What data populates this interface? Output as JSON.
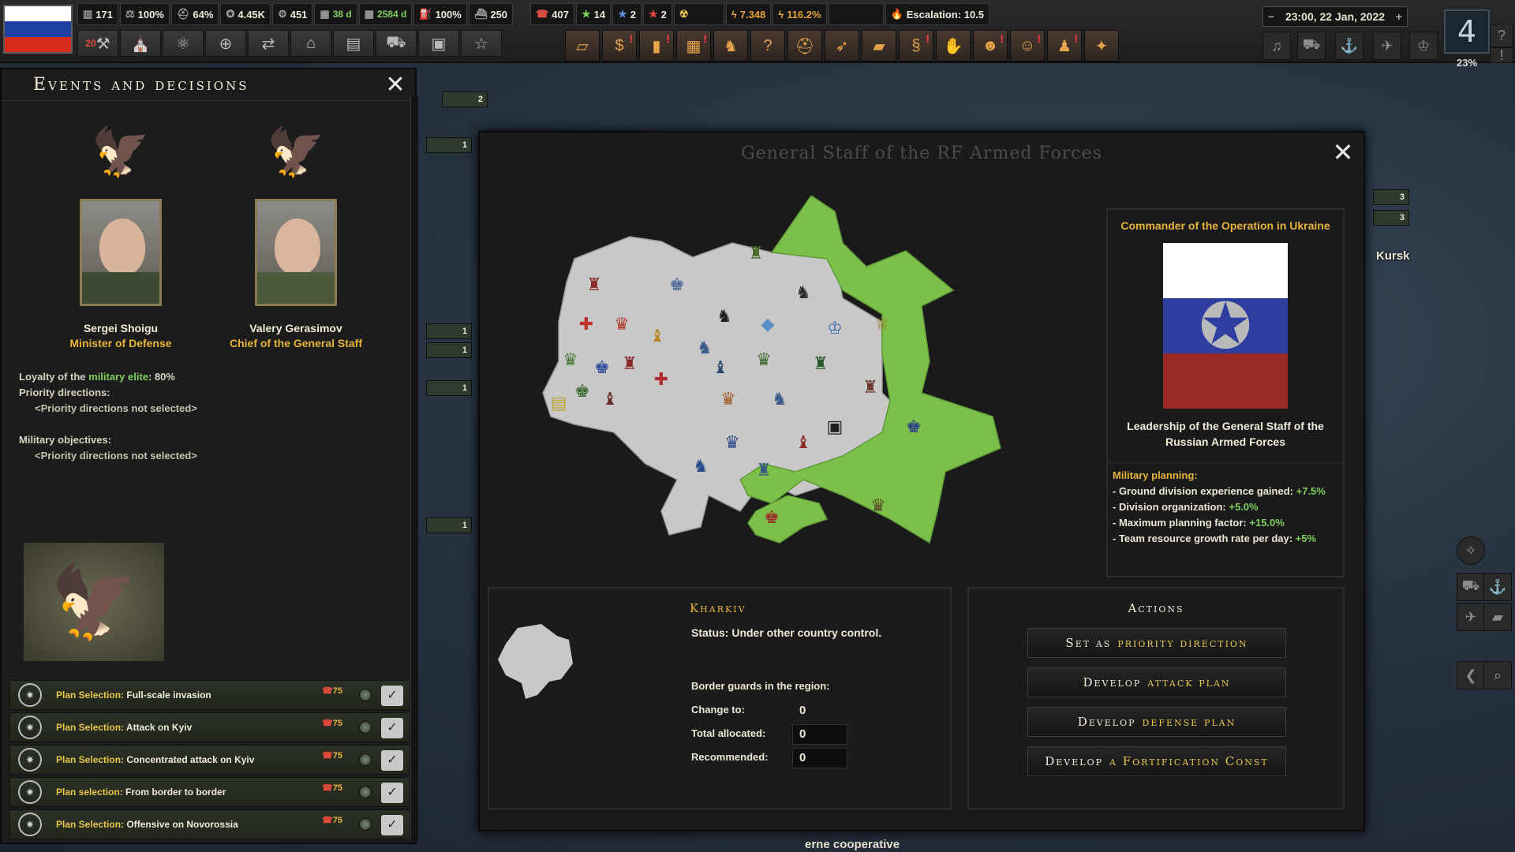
{
  "topbar": {
    "resources": [
      {
        "icon": "manpower-icon",
        "value": "171"
      },
      {
        "icon": "stability-icon",
        "value": "100%"
      },
      {
        "icon": "war-support-icon",
        "value": "64%"
      },
      {
        "icon": "army-icon",
        "value": "4.45K"
      },
      {
        "icon": "equipment-icon",
        "value": "451"
      },
      {
        "icon": "factory-icon",
        "value": "",
        "sub": "38 d"
      },
      {
        "icon": "production-icon",
        "value": "",
        "sub": "2584 d"
      },
      {
        "icon": "fuel-icon",
        "value": "100%"
      },
      {
        "icon": "convoy-icon",
        "value": "250"
      },
      {
        "icon": "politics-icon",
        "value": "407"
      },
      {
        "icon": "star-green-icon",
        "value": "14"
      },
      {
        "icon": "star-blue-icon",
        "value": "2"
      },
      {
        "icon": "star-red-icon",
        "value": "2"
      },
      {
        "icon": "nuclear-icon",
        "value": ""
      },
      {
        "icon": "energy-icon",
        "value": "7.348"
      },
      {
        "icon": "energy-ratio-icon",
        "value": "116.2%"
      },
      {
        "icon": "blank-icon",
        "value": ""
      },
      {
        "icon": "escalation-icon",
        "value": "Escalation: 10.5"
      }
    ],
    "flag_colors": [
      "#ffffff",
      "#1c3fa0",
      "#d52b1e"
    ],
    "date": "23:00, 22 Jan, 2022",
    "speed": "4",
    "speed_pct": "23%",
    "alert_badge": "20"
  },
  "events_panel": {
    "title": "Events and decisions",
    "person_left": {
      "name": "Sergei Shoigu",
      "role": "Minister of Defense"
    },
    "person_right": {
      "name": "Valery Gerasimov",
      "role": "Chief of the General Staff"
    },
    "loyalty_prefix": "Loyalty of the",
    "loyalty_highlight": "military elite",
    "loyalty_value": ": 80%",
    "priority_label": "Priority directions:",
    "priority_value": "<Priority directions not selected>",
    "objectives_label": "Military objectives:",
    "objectives_value": "<Priority directions not selected>",
    "plans": [
      {
        "label": "Plan Selection:",
        "text": "Full-scale invasion",
        "cost": "75"
      },
      {
        "label": "Plan Selection:",
        "text": "Attack on Kyiv",
        "cost": "75"
      },
      {
        "label": "Plan Selection:",
        "text": "Concentrated attack on Kyiv",
        "cost": "75"
      },
      {
        "label": "Plan selection:",
        "text": "From border to border",
        "cost": "75"
      },
      {
        "label": "Plan Selection:",
        "text": "Offensive on Novorossia",
        "cost": "75"
      }
    ]
  },
  "dialog": {
    "title": "General Staff of the RF Armed Forces",
    "commander": {
      "title": "Commander of the Operation in Ukraine",
      "subtitle": "Leadership of the General Staff of the Russian Armed Forces",
      "planning_head": "Military planning:",
      "planning": [
        {
          "text": "- Ground division experience gained:",
          "value": "+7.5%"
        },
        {
          "text": "- Division organization:",
          "value": "+5.0%"
        },
        {
          "text": "- Maximum planning factor:",
          "value": "+15.0%"
        },
        {
          "text": "- Team resource growth rate per day:",
          "value": "+5%"
        }
      ]
    },
    "region": {
      "name": "Kharkiv",
      "status": "Status: Under other country control.",
      "border_guards": "Border guards in the region:",
      "change_to_label": "Change to:",
      "change_to_value": "0",
      "total_label": "Total allocated:",
      "total_value": "0",
      "recommended_label": "Recommended:",
      "recommended_value": "0"
    },
    "actions": {
      "title": "Actions",
      "buttons": [
        {
          "a": "Set as",
          "b": "priority direction"
        },
        {
          "a": "Develop",
          "b": "attack plan"
        },
        {
          "a": "Develop",
          "b": "defense plan"
        },
        {
          "a": "Develop",
          "b": "a Fortification Const"
        }
      ]
    }
  },
  "map_labels": {
    "kursk": "Kursk",
    "bottom_text": "erne cooperative",
    "chips": [
      "2",
      "1",
      "1",
      "1",
      "1",
      "1",
      "3",
      "3"
    ]
  },
  "colors": {
    "occupied": "#7cc04a",
    "ukraine": "#c8c8c8",
    "accent_gold": "#e7c64a"
  }
}
